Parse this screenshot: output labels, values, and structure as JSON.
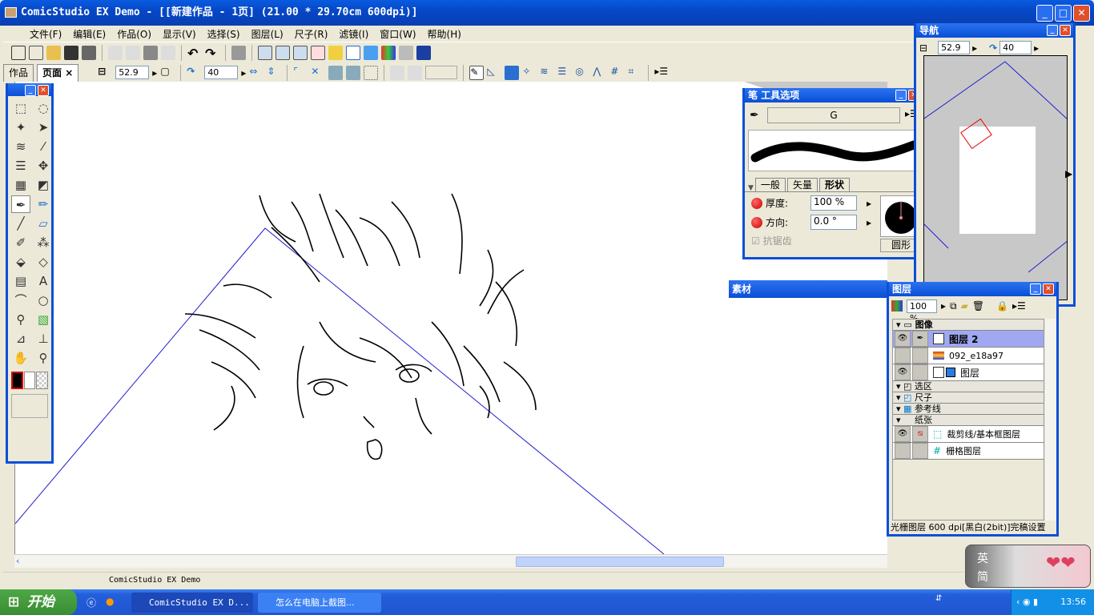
{
  "window": {
    "title": "ComicStudio EX Demo - [[新建作品 - 1页] (21.00 * 29.70cm 600dpi)]"
  },
  "menu": [
    "文件(F)",
    "编辑(E)",
    "作品(O)",
    "显示(V)",
    "选择(S)",
    "图层(L)",
    "尺子(R)",
    "滤镜(I)",
    "窗口(W)",
    "帮助(H)"
  ],
  "tabs": [
    {
      "label": "作品"
    },
    {
      "label": "页面"
    }
  ],
  "toolbar2": {
    "zoom": "52.9",
    "rotate": "40",
    "tab_close": "×"
  },
  "navigator": {
    "title": "导航",
    "zoom": "52.9",
    "rotate": "40"
  },
  "tool_options": {
    "title": "笔 工具选项",
    "brush_name": "G",
    "tabs": [
      "一般",
      "矢量",
      "形状"
    ],
    "thickness_label": "厚度:",
    "thickness": "100 %",
    "direction_label": "方向:",
    "direction": "0.0 °",
    "antialias_label": "抗锯齿",
    "shape": "圆形"
  },
  "materials": {
    "title": "素材"
  },
  "layers": {
    "title": "图层",
    "opacity": "100 %",
    "groups": {
      "image": "图像",
      "selection": "选区",
      "ruler": "尺子",
      "guide": "参考线",
      "paper": "纸张"
    },
    "image_layers": [
      "图层 2",
      "092_e18a97",
      "图层"
    ],
    "paper_layers": [
      "裁剪线/基本框图层",
      "栅格图层"
    ],
    "status": "光栅图层 600 dpi[黑白(2bit)]完稿设置"
  },
  "statusbar": {
    "text": "ComicStudio EX Demo"
  },
  "ime": {
    "line1": "英",
    "line2": "简"
  },
  "taskbar": {
    "start": "开始",
    "tasks": [
      "ComicStudio EX D...",
      "怎么在电脑上截图..."
    ],
    "clock": "13:56"
  }
}
